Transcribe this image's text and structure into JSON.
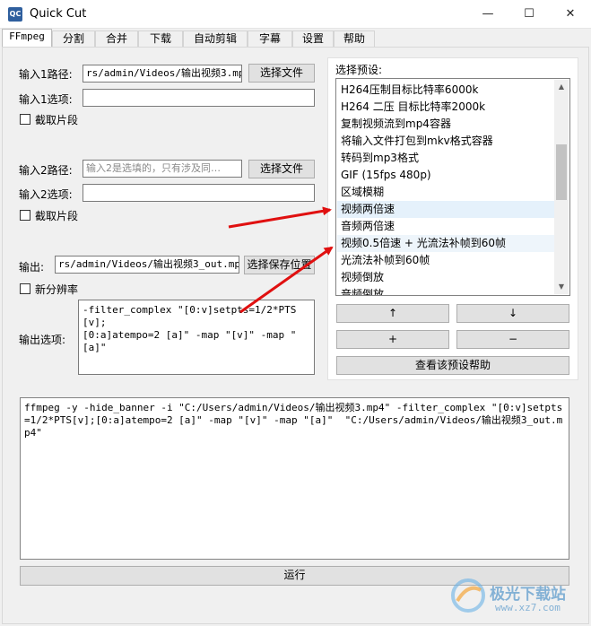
{
  "window": {
    "title": "Quick Cut",
    "icon_label": "QC",
    "minimize_glyph": "—",
    "maximize_glyph": "☐",
    "close_glyph": "✕"
  },
  "tabs": [
    {
      "label": "FFmpeg",
      "active": true
    },
    {
      "label": "分割"
    },
    {
      "label": "合并"
    },
    {
      "label": "下载"
    },
    {
      "label": "自动剪辑"
    },
    {
      "label": "字幕"
    },
    {
      "label": "设置"
    },
    {
      "label": "帮助"
    }
  ],
  "ffmpeg": {
    "input1": {
      "path_label": "输入1路径:",
      "path_value": "rs/admin/Videos/输出视频3.mp4",
      "choose_button": "选择文件",
      "options_label": "输入1选项:",
      "options_value": "",
      "clip_checkbox": "截取片段"
    },
    "input2": {
      "path_label": "输入2路径:",
      "path_placeholder": "输入2是选填的，只有涉及同…",
      "choose_button": "选择文件",
      "options_label": "输入2选项:",
      "options_value": "",
      "clip_checkbox": "截取片段"
    },
    "output": {
      "label": "输出:",
      "value": "rs/admin/Videos/输出视频3_out.mp4",
      "save_button": "选择保存位置",
      "new_resolution_checkbox": "新分辨率",
      "options_label": "输出选项:",
      "options_value": "-filter_complex \"[0:v]setpts=1/2*PTS[v];\n[0:a]atempo=2 [a]\" -map \"[v]\" -map \"[a]\""
    },
    "presets": {
      "label": "选择预设:",
      "items": [
        "H264压制目标比特率6000k",
        "H264 二压 目标比特率2000k",
        "复制视频流到mp4容器",
        "将输入文件打包到mkv格式容器",
        "转码到mp3格式",
        "GIF (15fps 480p)",
        "区域模糊",
        "视频两倍速",
        "音频两倍速",
        "视频0.5倍速 + 光流法补帧到60帧",
        "光流法补帧到60帧",
        "视频倒放",
        "音频倒放"
      ],
      "selected_index": 7,
      "up_button": "↑",
      "down_button": "↓",
      "add_button": "+",
      "remove_button": "−",
      "help_button": "查看该预设帮助",
      "scroll_up_glyph": "▲",
      "scroll_down_glyph": "▼"
    },
    "command": "ffmpeg -y -hide_banner -i \"C:/Users/admin/Videos/输出视频3.mp4\" -filter_complex \"[0:v]setpts=1/2*PTS[v];[0:a]atempo=2 [a]\" -map \"[v]\" -map \"[a]\"  \"C:/Users/admin/Videos/输出视频3_out.mp4\"",
    "run_button": "运行"
  },
  "watermark": {
    "text": "极光下载站",
    "url": "www.xz7.com"
  },
  "colors": {
    "highlight": "#e5f1fb",
    "arrow": "#e01010"
  }
}
